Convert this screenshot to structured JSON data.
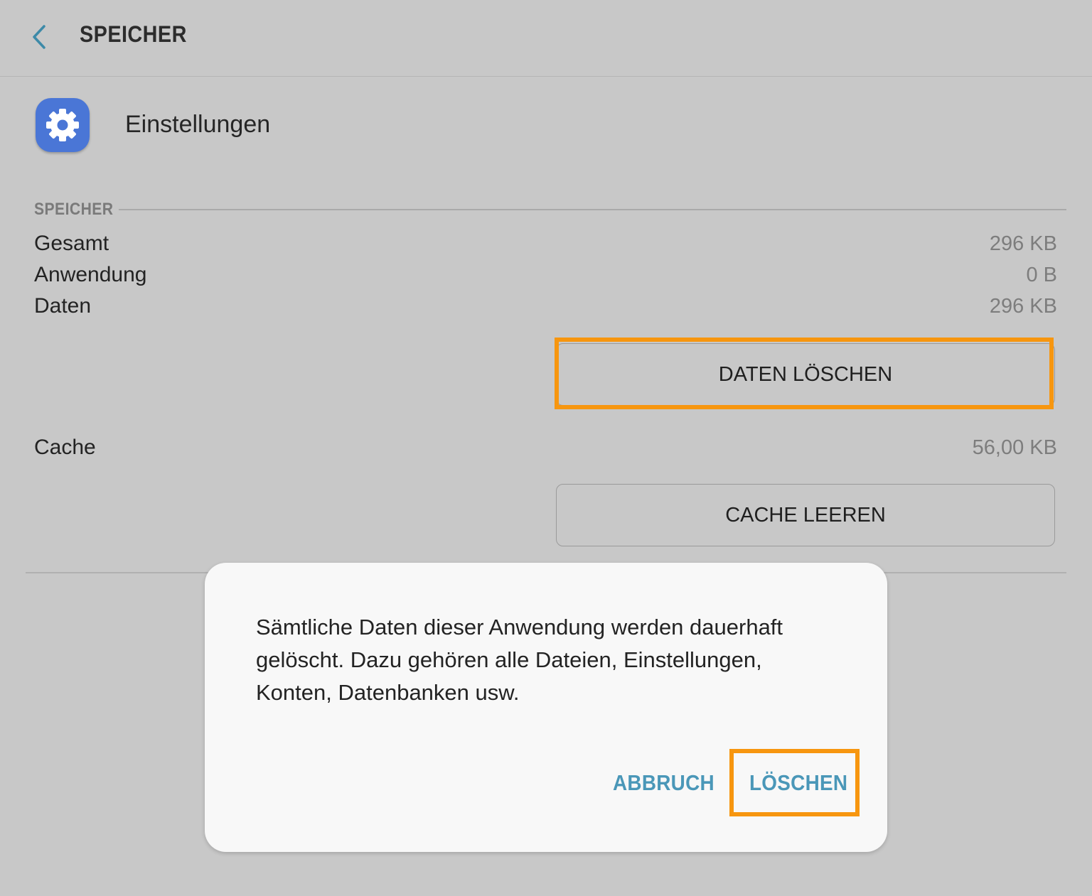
{
  "appbar": {
    "title": "SPEICHER",
    "back_icon": "chevron-left-icon"
  },
  "app": {
    "name": "Einstellungen",
    "icon": "gear-icon",
    "icon_color": "#4a76d6"
  },
  "storage": {
    "section_label": "SPEICHER",
    "rows": [
      {
        "label": "Gesamt",
        "value": "296 KB"
      },
      {
        "label": "Anwendung",
        "value": "0 B"
      },
      {
        "label": "Daten",
        "value": "296 KB"
      }
    ],
    "clear_data_label": "DATEN LÖSCHEN",
    "cache_label": "Cache",
    "cache_value": "56,00 KB",
    "clear_cache_label": "CACHE LEEREN"
  },
  "dialog": {
    "message": "Sämtliche Daten dieser Anwendung werden dauerhaft gelöscht. Dazu gehören alle Dateien, Einstellungen, Konten, Datenbanken usw.",
    "cancel_label": "ABBRUCH",
    "confirm_label": "LÖSCHEN"
  },
  "colors": {
    "highlight": "#f7960f",
    "accent": "#4a97b8",
    "background": "#c8c8c8"
  }
}
